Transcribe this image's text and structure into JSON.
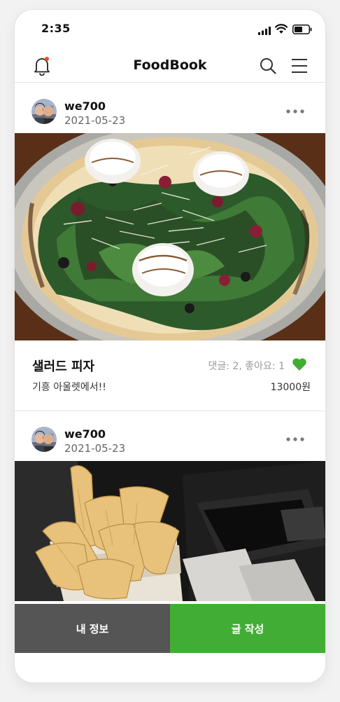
{
  "status_bar": {
    "time": "2:35"
  },
  "header": {
    "title": "FoodBook",
    "notification_dot_color": "#f04a24",
    "icons": [
      "bell-icon",
      "search-icon",
      "hamburger-menu-icon"
    ]
  },
  "posts": [
    {
      "username": "we700",
      "date": "2021-05-23",
      "image": "salad-pizza-photo",
      "title": "샐러드 피자",
      "stats": "댓글: 2, 좋아요: 1",
      "liked": true,
      "description": "기흥 아울렛에서!!",
      "price": "13000원"
    },
    {
      "username": "we700",
      "date": "2021-05-23",
      "image": "tortilla-chips-photo"
    }
  ],
  "bottom_bar": {
    "profile_label": "내 정보",
    "write_label": "글 작성",
    "profile_color": "#555555",
    "write_color": "#42ad34"
  },
  "colors": {
    "accent_green": "#42ad34",
    "heart": "#42ad34"
  }
}
